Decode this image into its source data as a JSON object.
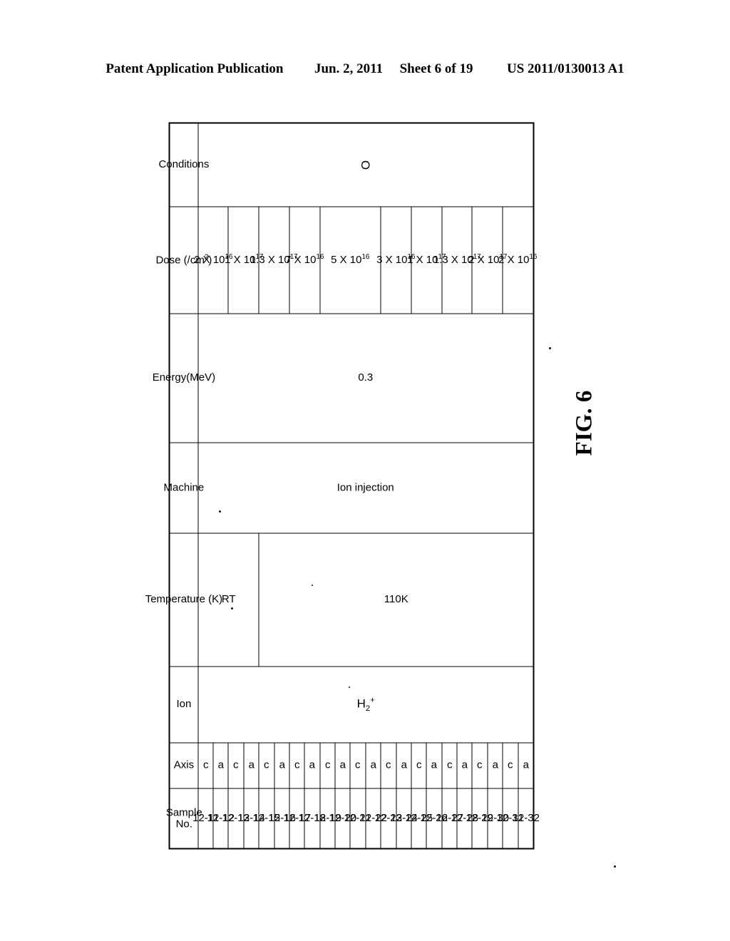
{
  "header": {
    "publication": "Patent Application Publication",
    "date": "Jun. 2, 2011",
    "sheet": "Sheet 6 of 19",
    "number": "US 2011/0130013 A1"
  },
  "figure": {
    "label": "FIG. 6"
  },
  "table": {
    "columns": [
      {
        "key": "sample",
        "label_line1": "Sample",
        "label_line2": "No."
      },
      {
        "key": "axis",
        "label": "Axis"
      },
      {
        "key": "ion",
        "label": "Ion"
      },
      {
        "key": "temperature",
        "label": "Temperature (K)"
      },
      {
        "key": "machine",
        "label": "Machine"
      },
      {
        "key": "energy",
        "label": "Energy(MeV)"
      },
      {
        "key": "dose",
        "label": "Dose (/cm2)",
        "label_base": "Dose (/cm",
        "label_sup": "2",
        "label_tail": ")"
      },
      {
        "key": "conditions",
        "label": "Conditions"
      }
    ],
    "samples": [
      "12-11",
      "12-12",
      "12-13",
      "12-14",
      "12-15",
      "12-16",
      "12-17",
      "12-18",
      "12-19",
      "12-20",
      "12-21",
      "12-22",
      "12-23",
      "12-24",
      "12-25",
      "12-26",
      "12-27",
      "12-28",
      "12-29",
      "12-30",
      "12-31",
      "12-32"
    ],
    "axis": [
      "c",
      "a",
      "c",
      "a",
      "c",
      "a",
      "c",
      "a",
      "c",
      "a",
      "c",
      "a",
      "c",
      "a",
      "c",
      "a",
      "c",
      "a",
      "c",
      "a",
      "c",
      "a"
    ],
    "ion": {
      "base": "H",
      "sub": "2",
      "sup": "+",
      "span": 22
    },
    "temperature": [
      {
        "value": "RT",
        "span": 4
      },
      {
        "value": "110K",
        "span": 18
      }
    ],
    "machine": [
      {
        "value": "Ion injection",
        "span": 22
      }
    ],
    "energy": [
      {
        "value": "0.3",
        "span": 22
      }
    ],
    "dose": [
      {
        "mantissa": "2 X 10",
        "exponent": "16",
        "span": 2
      },
      {
        "mantissa": "1 X 10",
        "exponent": "17",
        "span": 2
      },
      {
        "mantissa": "1.3 X 10",
        "exponent": "17",
        "span": 2
      },
      {
        "mantissa": "7 X 10",
        "exponent": "16",
        "span": 2
      },
      {
        "mantissa": "5 X 10",
        "exponent": "16",
        "span": 4
      },
      {
        "mantissa": "3 X 10",
        "exponent": "16",
        "span": 2
      },
      {
        "mantissa": "1 X 10",
        "exponent": "17",
        "span": 2
      },
      {
        "mantissa": "1.3 X 10",
        "exponent": "17",
        "span": 2
      },
      {
        "mantissa": "2 X 10",
        "exponent": "17",
        "span": 2
      },
      {
        "mantissa": "2 X 10",
        "exponent": "16",
        "span": 2
      }
    ],
    "conditions": [
      {
        "value": "O",
        "span": 22
      }
    ]
  }
}
